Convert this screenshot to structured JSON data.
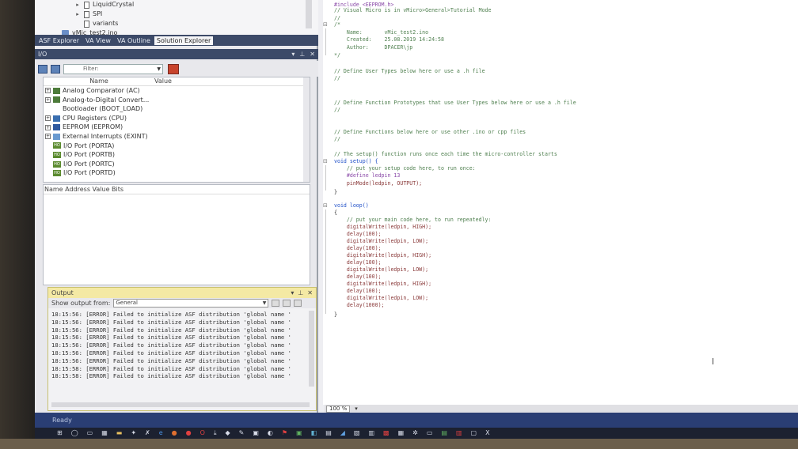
{
  "solution_tree": {
    "items": [
      {
        "label": "LiquidCrystal",
        "type": "folder"
      },
      {
        "label": "SPI",
        "type": "file"
      },
      {
        "label": "variants",
        "type": "file"
      },
      {
        "label": "vMic_test2.ino",
        "type": "project"
      }
    ]
  },
  "tabs": [
    "ASF Explorer",
    "VA View",
    "VA Outline",
    "Solution Explorer"
  ],
  "io_panel": {
    "title": "I/O",
    "filter_placeholder": "Filter:",
    "col_name": "Name",
    "col_value": "Value",
    "items": [
      {
        "label": "Analog Comparator (AC)",
        "expandable": true,
        "icon": "module-icon"
      },
      {
        "label": "Analog-to-Digital Convert...",
        "expandable": true,
        "icon": "module-icon"
      },
      {
        "label": "Bootloader (BOOT_LOAD)",
        "expandable": false,
        "icon": "none"
      },
      {
        "label": "CPU Registers (CPU)",
        "expandable": true,
        "icon": "cpu-icon"
      },
      {
        "label": "EEPROM (EEPROM)",
        "expandable": true,
        "icon": "eeprom-icon"
      },
      {
        "label": "External Interrupts (EXINT)",
        "expandable": true,
        "icon": "interrupt-icon"
      },
      {
        "label": "I/O Port (PORTA)",
        "expandable": false,
        "icon": "port-icon"
      },
      {
        "label": "I/O Port (PORTB)",
        "expandable": false,
        "icon": "port-icon"
      },
      {
        "label": "I/O Port (PORTC)",
        "expandable": false,
        "icon": "port-icon"
      },
      {
        "label": "I/O Port (PORTD)",
        "expandable": false,
        "icon": "port-icon"
      }
    ],
    "bits_header": "Name Address Value Bits"
  },
  "output": {
    "title": "Output",
    "show_label": "Show output from:",
    "source": "General",
    "lines": [
      "18:15:56: [ERROR] Failed to initialize ASF distribution 'global name '",
      "18:15:56: [ERROR] Failed to initialize ASF distribution 'global name '",
      "18:15:56: [ERROR] Failed to initialize ASF distribution 'global name '",
      "18:15:56: [ERROR] Failed to initialize ASF distribution 'global name '",
      "18:15:56: [ERROR] Failed to initialize ASF distribution 'global name '",
      "18:15:56: [ERROR] Failed to initialize ASF distribution 'global name '",
      "18:15:56: [ERROR] Failed to initialize ASF distribution 'global name '",
      "18:15:58: [ERROR] Failed to initialize ASF distribution 'global name '",
      "18:15:58: [ERROR] Failed to initialize ASF distribution 'global name '"
    ]
  },
  "editor": {
    "lines": [
      {
        "text": "#include <EEPROM.h>",
        "cls": "pp"
      },
      {
        "text": "// Visual Micro is in vMicro>General>Tutorial Mode",
        "cls": "cm"
      },
      {
        "text": "//",
        "cls": "cm"
      },
      {
        "text": "/*",
        "cls": "cm"
      },
      {
        "text": "    Name:       vMic_test2.ino",
        "cls": "cm"
      },
      {
        "text": "    Created:    25.08.2019 14:24:58",
        "cls": "cm"
      },
      {
        "text": "    Author:     DPACER\\jp",
        "cls": "cm"
      },
      {
        "text": "*/",
        "cls": "cm"
      },
      {
        "text": "// Define User Types below here or use a .h file",
        "cls": "cm"
      },
      {
        "text": "//",
        "cls": "cm"
      },
      {
        "text": "// Define Function Prototypes that use User Types below here or use a .h file",
        "cls": "cm"
      },
      {
        "text": "//",
        "cls": "cm"
      },
      {
        "text": "// Define Functions below here or use other .ino or cpp files",
        "cls": "cm"
      },
      {
        "text": "//",
        "cls": "cm"
      },
      {
        "text": "// The setup() function runs once each time the micro-controller starts",
        "cls": "cm"
      },
      {
        "text": "void setup() {",
        "cls": "kw"
      },
      {
        "text": "    // put your setup code here, to run once:",
        "cls": "cm"
      },
      {
        "text": "    #define ledpin 13",
        "cls": "pp"
      },
      {
        "text": "    pinMode(ledpin, OUTPUT);",
        "cls": "fn"
      },
      {
        "text": "}",
        "cls": "pl"
      },
      {
        "text": "void loop()",
        "cls": "kw"
      },
      {
        "text": "{",
        "cls": "pl"
      },
      {
        "text": "    // put your main code here, to run repeatedly:",
        "cls": "cm"
      },
      {
        "text": "    digitalWrite(ledpin, HIGH);",
        "cls": "fn"
      },
      {
        "text": "    delay(100);",
        "cls": "fn"
      },
      {
        "text": "    digitalWrite(ledpin, LOW);",
        "cls": "fn"
      },
      {
        "text": "    delay(100);",
        "cls": "fn"
      },
      {
        "text": "    digitalWrite(ledpin, HIGH);",
        "cls": "fn"
      },
      {
        "text": "    delay(100);",
        "cls": "fn"
      },
      {
        "text": "    digitalWrite(ledpin, LOW);",
        "cls": "fn"
      },
      {
        "text": "    delay(100);",
        "cls": "fn"
      },
      {
        "text": "    digitalWrite(ledpin, HIGH);",
        "cls": "fn"
      },
      {
        "text": "    delay(100);",
        "cls": "fn"
      },
      {
        "text": "    digitalWrite(ledpin, LOW);",
        "cls": "fn"
      },
      {
        "text": "    delay(1000);",
        "cls": "fn"
      },
      {
        "text": "}",
        "cls": "pl"
      }
    ],
    "zoom": "100 %"
  },
  "status": {
    "text": "Ready"
  },
  "taskbar": {
    "icons": [
      {
        "name": "start-icon",
        "glyph": "⊞",
        "color": "#d8dce8"
      },
      {
        "name": "search-icon",
        "glyph": "◯",
        "color": "#d8dce8"
      },
      {
        "name": "task-view-icon",
        "glyph": "▭",
        "color": "#d8dce8"
      },
      {
        "name": "calculator-icon",
        "glyph": "▦",
        "color": "#d8dce8"
      },
      {
        "name": "file-explorer-icon",
        "glyph": "▬",
        "color": "#e8c060"
      },
      {
        "name": "settings-icon",
        "glyph": "✦",
        "color": "#d8dce8"
      },
      {
        "name": "tool-icon",
        "glyph": "✗",
        "color": "#d8dce8"
      },
      {
        "name": "edge-icon",
        "glyph": "e",
        "color": "#4a90e0"
      },
      {
        "name": "firefox-icon",
        "glyph": "●",
        "color": "#e07030"
      },
      {
        "name": "chrome-icon",
        "glyph": "●",
        "color": "#e04040"
      },
      {
        "name": "opera-icon",
        "glyph": "O",
        "color": "#e04040"
      },
      {
        "name": "download-icon",
        "glyph": "⤓",
        "color": "#d8dce8"
      },
      {
        "name": "app-icon",
        "glyph": "◆",
        "color": "#d8dce8"
      },
      {
        "name": "pin-icon",
        "glyph": "✎",
        "color": "#d8dce8"
      },
      {
        "name": "app2-icon",
        "glyph": "▣",
        "color": "#d8dce8"
      },
      {
        "name": "paint-icon",
        "glyph": "◐",
        "color": "#d8dce8"
      },
      {
        "name": "flag-icon",
        "glyph": "⚑",
        "color": "#e04040"
      },
      {
        "name": "image-icon",
        "glyph": "▣",
        "color": "#60b060"
      },
      {
        "name": "ide-icon",
        "glyph": "◧",
        "color": "#60b0d0"
      },
      {
        "name": "app3-icon",
        "glyph": "▤",
        "color": "#d8dce8"
      },
      {
        "name": "app4-icon",
        "glyph": "◢",
        "color": "#60a0e0"
      },
      {
        "name": "app5-icon",
        "glyph": "▧",
        "color": "#d8dce8"
      },
      {
        "name": "app6-icon",
        "glyph": "▥",
        "color": "#d8dce8"
      },
      {
        "name": "app7-icon",
        "glyph": "▩",
        "color": "#e04040"
      },
      {
        "name": "grid-icon",
        "glyph": "▦",
        "color": "#d8dce8"
      },
      {
        "name": "gear-icon",
        "glyph": "✲",
        "color": "#d8dce8"
      },
      {
        "name": "monitor-icon",
        "glyph": "▭",
        "color": "#d8dce8"
      },
      {
        "name": "app8-icon",
        "glyph": "▤",
        "color": "#60b060"
      },
      {
        "name": "app9-icon",
        "glyph": "▥",
        "color": "#e04040"
      },
      {
        "name": "app10-icon",
        "glyph": "▢",
        "color": "#d8dce8"
      },
      {
        "name": "close-x-icon",
        "glyph": "X",
        "color": "#d8dce8"
      }
    ]
  }
}
